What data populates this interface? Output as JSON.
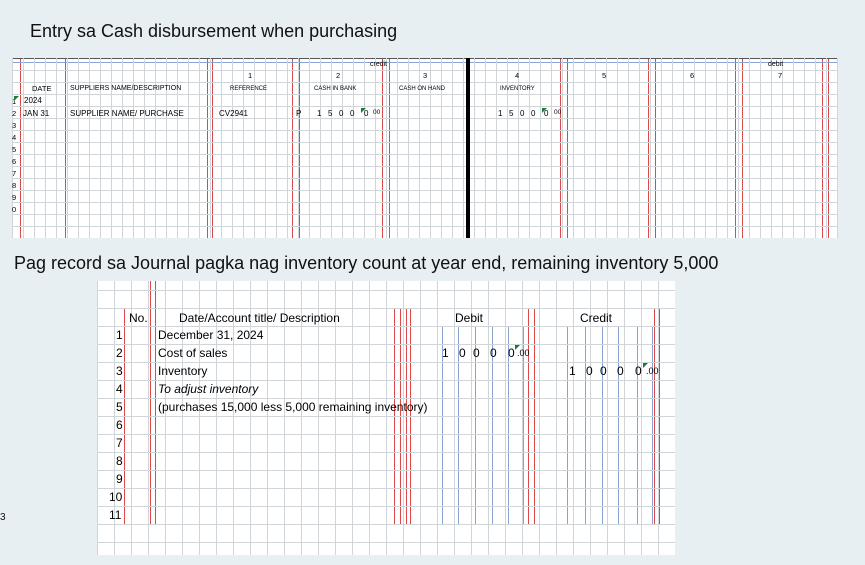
{
  "titles": {
    "cash_disbursement": "Entry sa Cash disbursement when purchasing",
    "journal": "Pag record sa Journal pagka nag inventory count at year end, remaining inventory 5,000"
  },
  "stray_mark": "3",
  "disbursement": {
    "group_credit": "credit",
    "group_debit": "debit",
    "col_numbers": [
      "1",
      "2",
      "3",
      "4",
      "5",
      "6",
      "7"
    ],
    "headers": {
      "date": "DATE",
      "supplier": "SUPPLIERS NAME/DESCRIPTION",
      "reference": "REFERENCE",
      "cash_in_bank": "CASH IN BANK",
      "cash_on_hand": "CASH ON HAND",
      "inventory": "INVENTORY"
    },
    "row_numbers": [
      "1",
      "2",
      "3",
      "4",
      "5",
      "6",
      "7",
      "8",
      "9",
      "0"
    ],
    "row1_date": "2024",
    "row2": {
      "date": "JAN 31",
      "supplier": "SUPPLIER NAME/ PURCHASE",
      "reference": "CV2941",
      "mark": "P",
      "cash_in_bank_digits": [
        "1",
        "5",
        "0",
        "0",
        "0"
      ],
      "cash_in_bank_cents": "00",
      "inventory_digits": [
        "1",
        "5",
        "0",
        "0",
        "0"
      ],
      "inventory_cents": "00"
    }
  },
  "journal": {
    "header_no": "No.",
    "header_desc": "Date/Account title/ Description",
    "header_debit": "Debit",
    "header_credit": "Credit",
    "row_numbers": [
      "1",
      "2",
      "3",
      "4",
      "5",
      "6",
      "7",
      "8",
      "9",
      "10",
      "11"
    ],
    "desc": [
      "December 31, 2024",
      "Cost of sales",
      "Inventory",
      "To adjust inventory",
      "(purchases 15,000 less 5,000 remaining inventory)"
    ],
    "debit_digits": [
      "1",
      "0",
      "0",
      "0",
      "0"
    ],
    "debit_cents": ".00",
    "credit_digits": [
      "1",
      "0",
      "0",
      "0",
      "0"
    ],
    "credit_cents": ".00"
  }
}
